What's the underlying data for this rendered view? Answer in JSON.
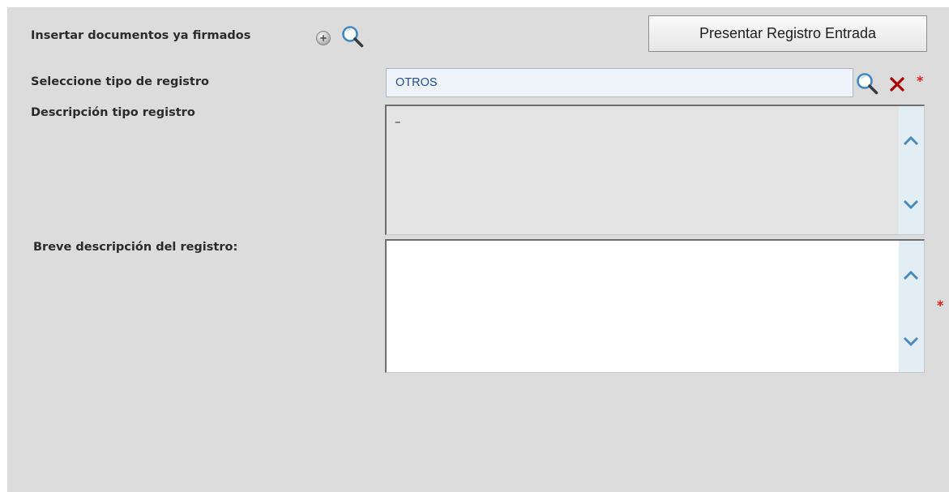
{
  "insert_docs": {
    "label": "Insertar documentos ya firmados"
  },
  "toolbar": {
    "present_label": "Presentar Registro Entrada"
  },
  "tipo_registro": {
    "label": "Seleccione tipo de registro",
    "value": "OTROS",
    "required_mark": "*"
  },
  "descripcion_tipo": {
    "label": "Descripción tipo registro",
    "value": "–"
  },
  "breve_descripcion": {
    "label": "Breve descripción del registro:",
    "value": "",
    "required_mark": "*"
  },
  "icons": {
    "add": "add-circle-icon",
    "search": "magnifier-icon",
    "clear": "close-icon",
    "scroll_up": "chevron-up-icon",
    "scroll_down": "chevron-down-icon"
  },
  "colors": {
    "panel_bg": "#dcdcdc",
    "input_bg": "#eef4fa",
    "input_text": "#1f4c9e",
    "required": "#e01a1a",
    "clear_icon": "#b00000",
    "scrollbar_bg": "#e2eef4",
    "chevron": "#4a8cc0"
  }
}
